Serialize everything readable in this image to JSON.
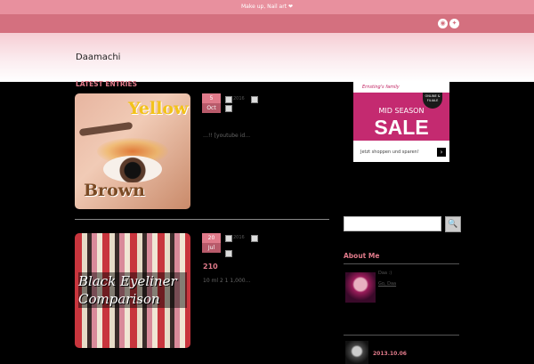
{
  "topbar": {
    "text": "Make up, Nail art ❤"
  },
  "social": {
    "rss_icon": "rss-icon",
    "twitter_icon": "twitter-icon"
  },
  "header": {
    "site_title": "Daamachi"
  },
  "main": {
    "section_label": "LATEST ENTRIES",
    "posts": [
      {
        "day": "5",
        "month": "Oct",
        "meta_author": "2016",
        "meta_comments": "",
        "image_text_1": "Yellow",
        "image_text_2": "Brown",
        "excerpt": "…!!   [youtube id…"
      },
      {
        "day": "20",
        "month": "Jul",
        "meta_author": "2016",
        "meta_comments": "",
        "image_text": "Black Eyeliner Comparison",
        "title": "210",
        "excerpt": "10 ml 2 1 1,000…"
      }
    ]
  },
  "sidebar": {
    "ad": {
      "brand": "Ernsting's family",
      "badge": "ONLINE & FILIALE",
      "headline": "MID SEASON",
      "sale": "SALE",
      "footer": "Jetzt shoppen und sparen!",
      "arrow": "›"
    },
    "search": {
      "placeholder": "",
      "button": "🔍"
    },
    "about": {
      "title": "About Me",
      "name": "Daa :)",
      "link": "Go, Daa"
    },
    "recent": {
      "date": "2013.10.06"
    }
  }
}
